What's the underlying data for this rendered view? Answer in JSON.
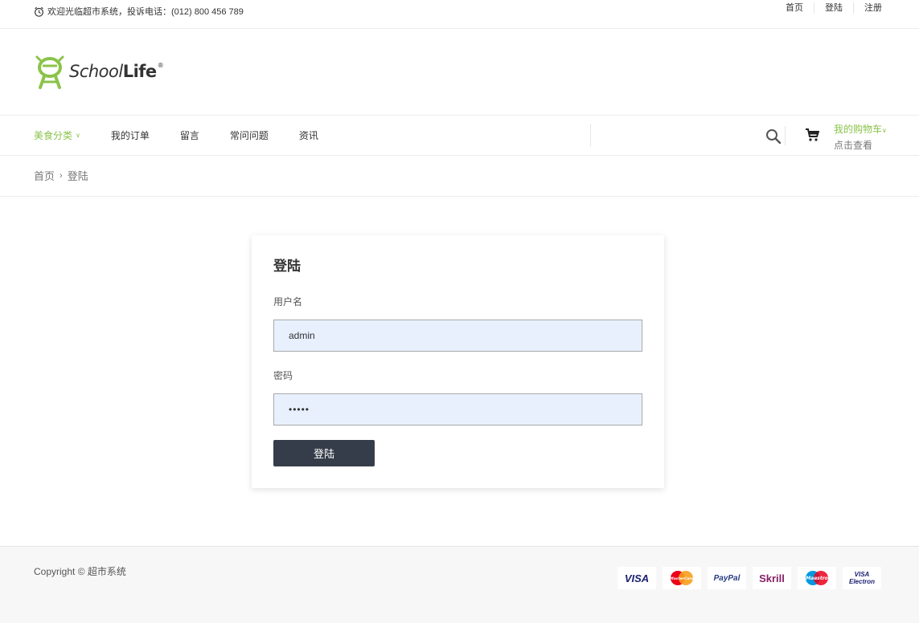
{
  "topbar": {
    "welcome": "欢迎光临超市系统，投诉电话：(012) 800 456 789",
    "links": [
      "首页",
      "登陆",
      "注册"
    ]
  },
  "logo": {
    "text_italic": "School",
    "text_bold": "Life",
    "registered": "®"
  },
  "nav": {
    "items": [
      "美食分类",
      "我的订单",
      "留言",
      "常问问题",
      "资讯"
    ],
    "active_color": "#8bc34a"
  },
  "cart": {
    "label": "我的购物车",
    "sub": "点击查看"
  },
  "breadcrumb": {
    "home": "首页",
    "current": "登陆"
  },
  "login": {
    "title": "登陆",
    "username_label": "用户名",
    "username_value": "admin",
    "password_label": "密码",
    "password_value": "•••••",
    "submit_label": "登陆"
  },
  "footer": {
    "copyright": "Copyright © 超市系统",
    "payments": [
      "VISA",
      "MasterCard",
      "PayPal",
      "Skrill",
      "Maestro",
      "VISA Electron"
    ]
  },
  "colors": {
    "accent": "#8bc34a",
    "button": "#363d4a",
    "input_bg": "#e8f0fe"
  }
}
